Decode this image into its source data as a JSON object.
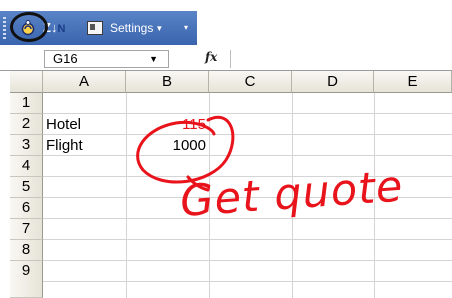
{
  "toolbar": {
    "settings_label": "Settings",
    "settings_arrow": "▼",
    "overflow_glyph": "▾",
    "sort_label": "Z↓",
    "sort_sub": "N"
  },
  "formula_bar": {
    "name_box": "G16",
    "name_box_arrow": "▼",
    "fx": "fx",
    "value": ""
  },
  "sheet": {
    "columns": [
      "A",
      "B",
      "C",
      "D",
      "E"
    ],
    "rows": [
      "1",
      "2",
      "3",
      "4",
      "5",
      "6",
      "7",
      "8",
      "9"
    ],
    "cells": {
      "A2": "Hotel",
      "B2": "115",
      "A3": "Flight",
      "B3": "1000"
    }
  },
  "annotations": {
    "handwritten_note": "Get quote",
    "ink_color": "#e8131b",
    "circle_color": "#111111"
  },
  "colors": {
    "toolbar": "#4a74bb",
    "header_bg": "#ece9d8",
    "gridline": "#d4d4d4",
    "faded_value": "#e8131b"
  }
}
